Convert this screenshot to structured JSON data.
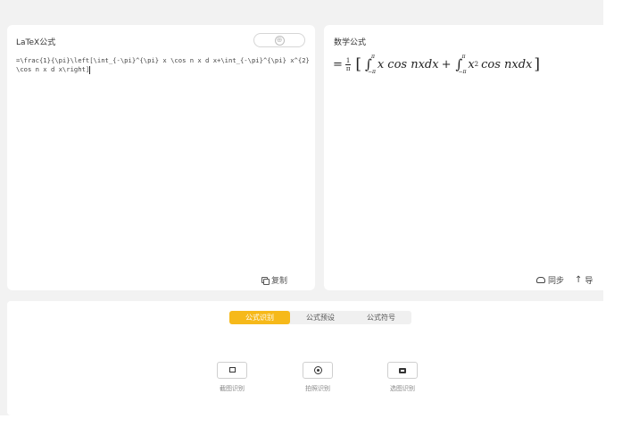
{
  "latex_panel": {
    "title": "LaTeX公式",
    "add_button": "⊕",
    "code": "=\\frac{1}{\\pi}\\left[\\int_{-\\pi}^{\\pi} x \\cos n x d x+\\int_{-\\pi}^{\\pi} x^{2} \\cos n x d x\\right]",
    "copy_label": "复制"
  },
  "math_panel": {
    "title": "数学公式",
    "formula": {
      "equals": "=",
      "frac_num": "1",
      "frac_den": "π",
      "lbracket": "[",
      "rbracket": "]",
      "int_upper": "π",
      "int_lower": "−π",
      "term1": "x cos nxdx",
      "plus": "+",
      "term2_base": "x",
      "term2_exp": "2",
      "term2_rest": "cos nxdx"
    },
    "sync_label": "同步",
    "export_label": "导"
  },
  "bottom": {
    "tabs": [
      {
        "label": "公式识别",
        "active": true
      },
      {
        "label": "公式预设",
        "active": false
      },
      {
        "label": "公式符号",
        "active": false
      }
    ],
    "tools": [
      {
        "label": "截图识别",
        "icon": "crop-icon"
      },
      {
        "label": "拍照识别",
        "icon": "camera-icon"
      },
      {
        "label": "选图识别",
        "icon": "image-icon"
      }
    ]
  },
  "colors": {
    "accent": "#f6b91a",
    "background": "#f2f2f2"
  }
}
